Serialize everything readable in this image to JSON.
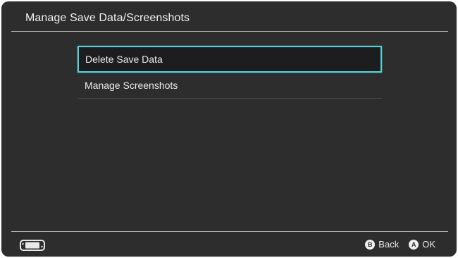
{
  "header": {
    "title": "Manage Save Data/Screenshots"
  },
  "menu": {
    "items": [
      {
        "label": "Delete Save Data",
        "selected": true
      },
      {
        "label": "Manage Screenshots",
        "selected": false
      }
    ]
  },
  "footer": {
    "console_icon": "switch-console-icon",
    "back": {
      "glyph": "B",
      "label": "Back"
    },
    "ok": {
      "glyph": "A",
      "label": "OK"
    }
  },
  "colors": {
    "background": "#2d2d2d",
    "selection_border": "#56d3d8",
    "selection_fill": "#1d1d1f",
    "text": "#ececec"
  }
}
